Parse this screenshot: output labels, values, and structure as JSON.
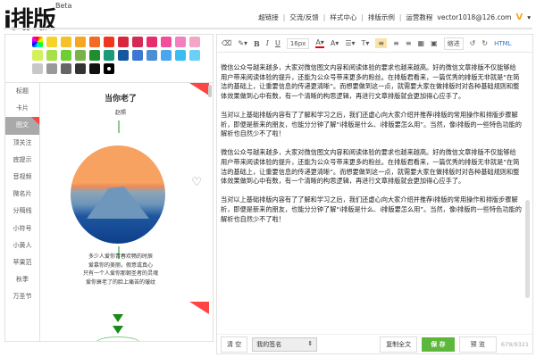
{
  "header": {
    "logo": "i排版",
    "beta": "Beta",
    "nav": [
      "超链接",
      "交流/反馈",
      "样式中心",
      "排版示例",
      "运营教程"
    ],
    "user": "vector1018@126.com",
    "vip": "V"
  },
  "palette": {
    "colors": [
      "rainbow",
      "#f5d328",
      "#f6c02a",
      "#f5a623",
      "#f56a23",
      "#f0361f",
      "#d8263f",
      "#d42a55",
      "#e82d6e",
      "#f24e9b",
      "#f57fbd",
      "#f5a6c8",
      "#d4f05a",
      "#a8e04a",
      "#6ecf34",
      "#7ab24a",
      "#1e8e2e",
      "#1a9a78",
      "#1658a0",
      "#3a78d4",
      "#4a8ed4",
      "#4aa6f0",
      "#3abcf0",
      "#6ad0f5",
      "#c8c8c8",
      "#999999",
      "#666666",
      "#333333",
      "#111111",
      "#000000"
    ]
  },
  "categories": [
    "标题",
    "卡片",
    "图文",
    "顶关注",
    "底提示",
    "音视频",
    "微名片",
    "分隔线",
    "小符号",
    "小黄人",
    "苹果范",
    "秋季",
    "万圣节"
  ],
  "active_category": "图文",
  "preview": {
    "title": "当你老了",
    "author": "赵照",
    "poem": [
      "多少人爱你青春欢畅的时辰",
      "爱慕你的美丽，假意或真心",
      "只有一个人爱你那朝圣者的灵魂",
      "爱你衰老了的脸上痛苦的皱纹"
    ]
  },
  "toolbar": {
    "font_size": "16px",
    "indent_label": "缩进",
    "html": "HTML"
  },
  "content": {
    "paragraphs": [
      "微信公众号越来越多，大家对微信图文内容和阅读体验的要求也越来越高。好的微信文章排版不仅能够给用户带来阅读体验的提升，还能为公众号带来更多的粉丝。在排版君看来，一篇优秀的排版无非就是“在简洁的基础上，让重要信息的传递更清晰”。而想要做到这一点，就需要大家在做排版时对各种基础规则和整体效果做到心中有数，有一个清晰的构思逻辑，再进行文章排版就会更加得心应手了。",
      "当对以上基础排版内容有了了解和学习之后，我们还虚心向大家介绍并推荐i排版的常用操作和排版步骤解析，即便是新来的朋友，也能分分钟了解“i排版是什么、i排版要怎么用”。当然，像i排版的一些特色功能的解析也自然少不了啦！",
      "微信公众号越来越多，大家对微信图文内容和阅读体验的要求也越来越高。好的微信文章排版不仅能够给用户带来阅读体验的提升，还能为公众号带来更多的粉丝。在排版君看来，一篇优秀的排版无非就是“在简洁的基础上，让重要信息的传递更清晰”。而想要做到这一点，就需要大家在做排版时对各种基础规则和整体效果做到心中有数，有一个清晰的构思逻辑，再进行文章排版就会更加得心应手了。",
      "当对以上基础排版内容有了了解和学习之后，我们还虚心向大家介绍并推荐i排版的常用操作和排版步骤解析，即便是新来的朋友，也能分分钟了解“i排版是什么、i排版要怎么用”。当然，像i排版的一些特色功能的解析也自然少不了啦！"
    ]
  },
  "footer": {
    "clear": "清 空",
    "signature": "我的签名",
    "copy": "复制全文",
    "save": "保 存",
    "preview": "预 览",
    "count": "679/9321"
  }
}
